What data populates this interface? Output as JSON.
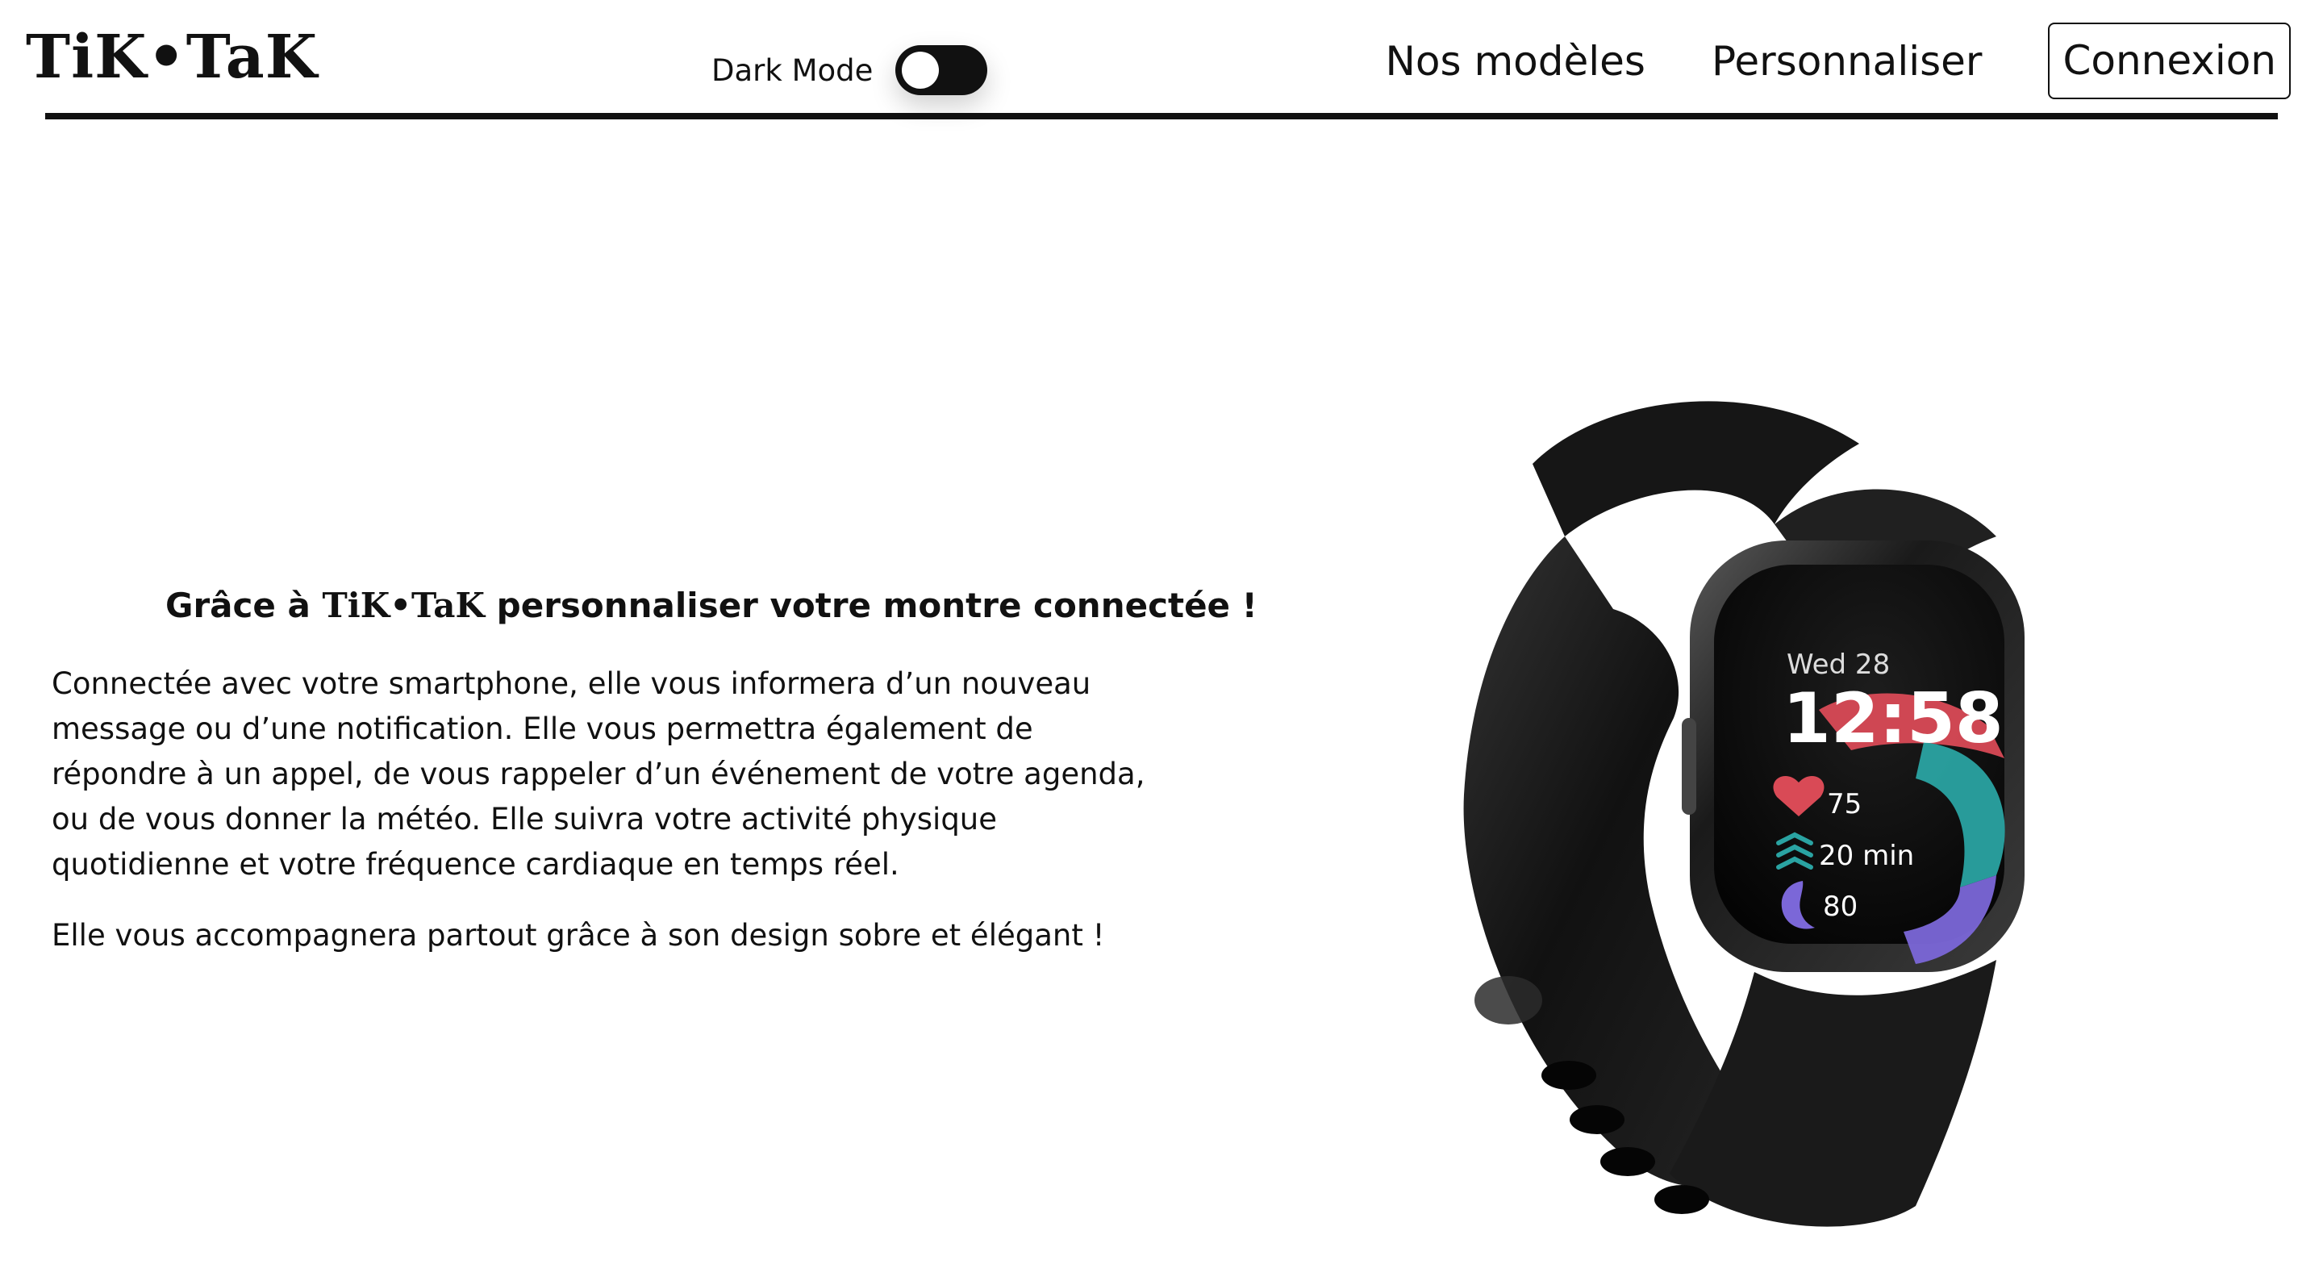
{
  "header": {
    "logo": "TiK•TaK",
    "dark_mode_label": "Dark Mode",
    "nav": [
      {
        "label": "Nos modèles"
      },
      {
        "label": "Personnaliser"
      }
    ],
    "login_label": "Connexion"
  },
  "intro": {
    "prefix": "Grâce à ",
    "brand": "TiK•TaK",
    "suffix": " personnaliser votre montre connectée !"
  },
  "description": [
    "Connectée avec votre smartphone, elle vous informera d’un nouveau message ou d’une notification. Elle vous permettra également de répondre à un appel, de vous rappeler d’un événement de votre agenda, ou de vous donner la météo. Elle suivra votre activité physique quotidienne et votre fréquence cardiaque en temps réel.",
    "Elle vous accompagnera partout grâce à son design sobre et élégant !"
  ],
  "watch": {
    "date": "Wed 28",
    "time": "12:58",
    "heart_rate": "75",
    "activity": "20 min",
    "sleep": "80"
  },
  "colors": {
    "text": "#111111",
    "background": "#ffffff",
    "watch_band": "#1c1c1c",
    "watch_screen": "#050505",
    "heart": "#d94a56",
    "teal": "#2aa3a2",
    "purple": "#7b67d8"
  },
  "icons": {
    "heart": "heart-icon",
    "activity": "activity-wave-icon",
    "sleep": "moon-icon"
  }
}
